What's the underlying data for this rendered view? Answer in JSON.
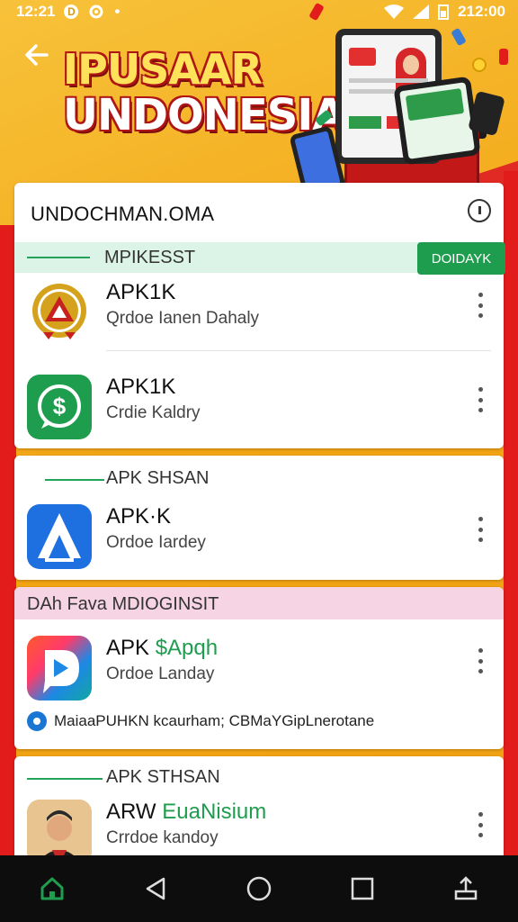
{
  "status_bar": {
    "time": "12:21",
    "right_time": "212:00"
  },
  "header": {
    "title_line1": "IPUSAAR",
    "title_line2": "UNDONESIA"
  },
  "search": {
    "value": "UNDOCHMAN.OMA"
  },
  "section1": {
    "label": "MPIKESST",
    "action_label": "DOIDAYK"
  },
  "apps1": [
    {
      "name": "APK1K",
      "subtitle": "Qrdoe Ianen Dahaly"
    },
    {
      "name": "APK1K",
      "subtitle": "Crdie Kaldry"
    }
  ],
  "section2": {
    "label": "APK SHSAN"
  },
  "apps2": [
    {
      "name": "APK·K",
      "subtitle": "Ordoe Iardey"
    }
  ],
  "section3": {
    "label": "DAh Fava MDIOGINSIT"
  },
  "apps3": [
    {
      "name_prefix": "APK ",
      "name_highlight": "$Apqh",
      "subtitle": "Ordoe Landay"
    }
  ],
  "promo": {
    "text": "MaiaaPUHKN kcaurham; CBMaYGipLnerotane"
  },
  "section4": {
    "label": "APK STHSAN"
  },
  "apps4": [
    {
      "name_prefix": "ARW ",
      "name_highlight": "EuaNisium",
      "subtitle": "Crrdoe kandoy"
    }
  ],
  "colors": {
    "accent_green": "#1f9d4e",
    "brand_yellow": "#f4b21c",
    "brand_red": "#e21b1b"
  },
  "icons": {
    "app1": "award-badge-icon",
    "app2": "dollar-chat-icon",
    "app3": "a-logo-icon",
    "app4": "d-logo-icon",
    "app5": "person-photo-icon"
  }
}
